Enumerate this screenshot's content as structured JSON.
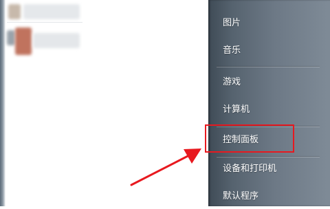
{
  "right_menu": {
    "items": [
      {
        "label": "图片"
      },
      {
        "label": "音乐"
      },
      {
        "label": "游戏"
      },
      {
        "label": "计算机"
      },
      {
        "label": "控制面板"
      },
      {
        "label": "设备和打印机"
      },
      {
        "label": "默认程序"
      }
    ]
  },
  "annotation": {
    "highlight_color": "#e8191f",
    "highlighted_item": "控制面板"
  },
  "left_pane": {
    "redacted_items": 2
  }
}
